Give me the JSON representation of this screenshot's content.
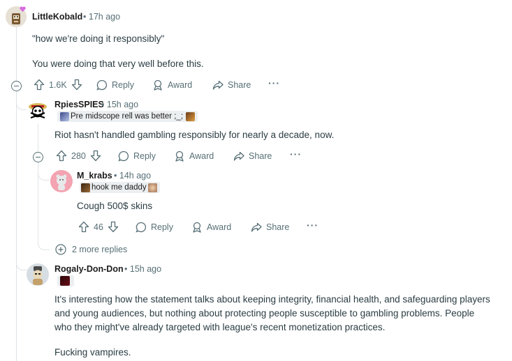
{
  "comments": [
    {
      "username": "LittleKobald",
      "time": "17h ago",
      "flair": "",
      "body": [
        "\"how we're doing it responsibly\"",
        "",
        "You were doing that very well before this."
      ],
      "votes": "1.6K",
      "actions": {
        "reply": "Reply",
        "award": "Award",
        "share": "Share"
      }
    },
    {
      "username": "RpiesSPIES",
      "time": "15h ago",
      "flair": "Pre midscope rell was better ;_;",
      "body": [
        "Riot hasn't handled gambling responsibly for nearly a decade, now."
      ],
      "votes": "280",
      "actions": {
        "reply": "Reply",
        "award": "Award",
        "share": "Share"
      }
    },
    {
      "username": "M_krabs",
      "time": "14h ago",
      "flair": "hook me daddy",
      "body": [
        "Cough 500$ skins"
      ],
      "votes": "46",
      "actions": {
        "reply": "Reply",
        "award": "Award",
        "share": "Share"
      }
    },
    {
      "username": "Rogaly-Don-Don",
      "time": "15h ago",
      "flair": "",
      "body": [
        "It's interesting how the statement talks about keeping integrity, financial health, and safeguarding players",
        "and young audiences, but nothing about protecting people susceptible to gambling problems. People",
        "who they might've already targeted with league's recent monetization practices.",
        "",
        "Fucking vampires."
      ]
    }
  ],
  "more_replies": "2 more replies",
  "separator": "•",
  "colors": {
    "text": "#1c1c1c",
    "muted": "#576f76",
    "line": "#dfe3e6",
    "flair_bg": "#eceff1"
  }
}
